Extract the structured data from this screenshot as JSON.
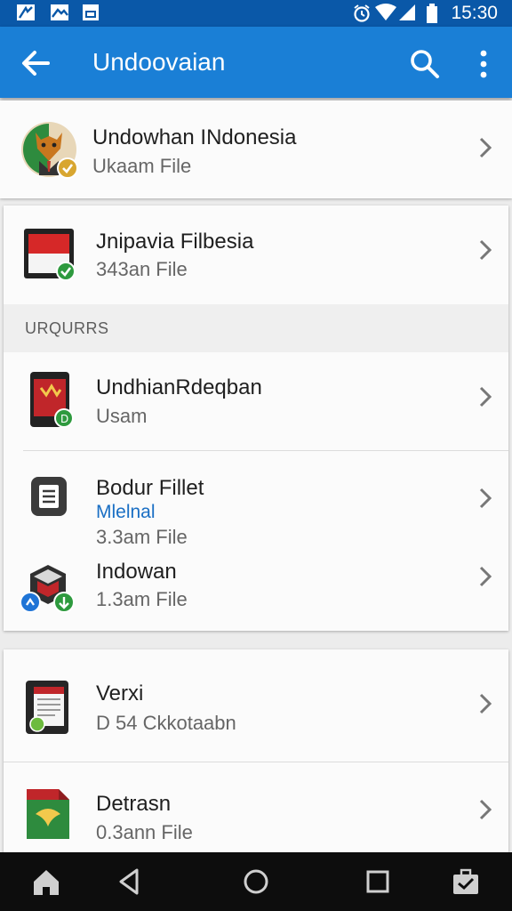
{
  "status_bar": {
    "time": "15:30",
    "icons": [
      "notification-icon",
      "image-icon",
      "gallery-icon",
      "alarm-icon",
      "wifi-icon",
      "signal-icon",
      "battery-icon"
    ]
  },
  "app_bar": {
    "title": "Undoovaian",
    "icons": [
      "back-arrow-icon",
      "search-icon",
      "more-vert-icon"
    ]
  },
  "items": [
    {
      "title": "Undowhan INdonesia",
      "subtitle": "Ukaam File"
    },
    {
      "title": "Jnipavia Filbesia",
      "subtitle": "343an File"
    }
  ],
  "section": {
    "header": "URQURRS",
    "items": [
      {
        "title": "UndhianRdeqban",
        "subtitle": "Usam"
      },
      {
        "title": "Bodur Fillet",
        "link": "Mlelnal",
        "subtitle": "3.3am File"
      },
      {
        "title": "Indowan",
        "subtitle": "1.3am File"
      }
    ]
  },
  "more_items": [
    {
      "title": "Verxi",
      "subtitle": "D 54 Ckkotaabn"
    },
    {
      "title": "Detrasn",
      "subtitle": "0.3ann File"
    }
  ],
  "nav_bar": {
    "icons": [
      "home-icon",
      "back-triangle-icon",
      "home-circle-icon",
      "recents-square-icon",
      "briefcase-icon"
    ]
  },
  "colors": {
    "status_bar": "#0a58a8",
    "app_bar": "#1a7fd6",
    "badge_green": "#2e9a3e",
    "badge_blue": "#1f74d6"
  }
}
